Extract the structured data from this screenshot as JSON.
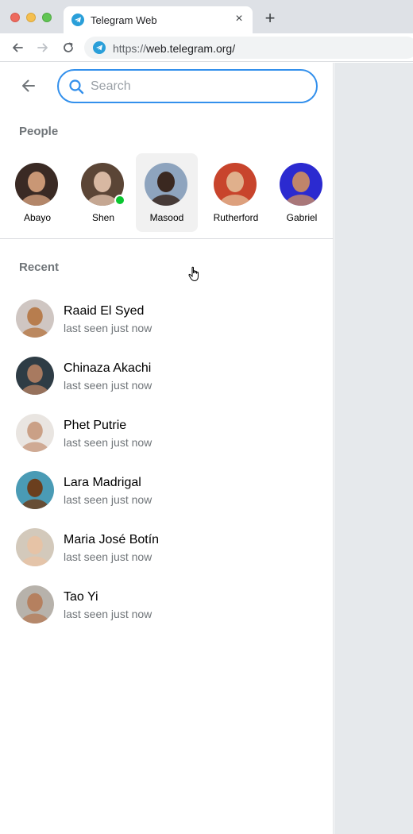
{
  "browser": {
    "tab_title": "Telegram Web",
    "tab_close": "×",
    "new_tab": "+",
    "url_scheme": "https://",
    "url_rest": "web.telegram.org/"
  },
  "search": {
    "placeholder": "Search"
  },
  "people": {
    "title": "People",
    "items": [
      {
        "name": "Abayo",
        "online": false,
        "avatar_colors": [
          "#3a2a24",
          "#c99775"
        ]
      },
      {
        "name": "Shen",
        "online": true,
        "avatar_colors": [
          "#5b4536",
          "#d8b8a2"
        ]
      },
      {
        "name": "Masood",
        "online": false,
        "avatar_colors": [
          "#8ea4be",
          "#3a2820"
        ]
      },
      {
        "name": "Rutherford",
        "online": false,
        "avatar_colors": [
          "#c8442c",
          "#e0b08c"
        ]
      },
      {
        "name": "Gabriel",
        "online": false,
        "avatar_colors": [
          "#2b2ad0",
          "#c0856a"
        ]
      }
    ]
  },
  "recent": {
    "title": "Recent",
    "items": [
      {
        "name": "Raaid El Syed",
        "status": "last seen just now",
        "avatar_colors": [
          "#cfc6c2",
          "#b77d4e"
        ]
      },
      {
        "name": "Chinaza Akachi",
        "status": "last seen just now",
        "avatar_colors": [
          "#2e3c45",
          "#a87a60"
        ]
      },
      {
        "name": "Phet Putrie",
        "status": "last seen just now",
        "avatar_colors": [
          "#e9e5e1",
          "#caa086"
        ]
      },
      {
        "name": "Lara Madrigal",
        "status": "last seen just now",
        "avatar_colors": [
          "#4a9bb5",
          "#6b3f1e"
        ]
      },
      {
        "name": "Maria José Botín",
        "status": "last seen just now",
        "avatar_colors": [
          "#d3c9bb",
          "#e6c3a6"
        ]
      },
      {
        "name": "Tao Yi",
        "status": "last seen just now",
        "avatar_colors": [
          "#b7b2ab",
          "#b5805f"
        ]
      }
    ]
  },
  "colors": {
    "accent": "#3390ec",
    "online": "#0ac630",
    "secondary_text": "#707579"
  }
}
